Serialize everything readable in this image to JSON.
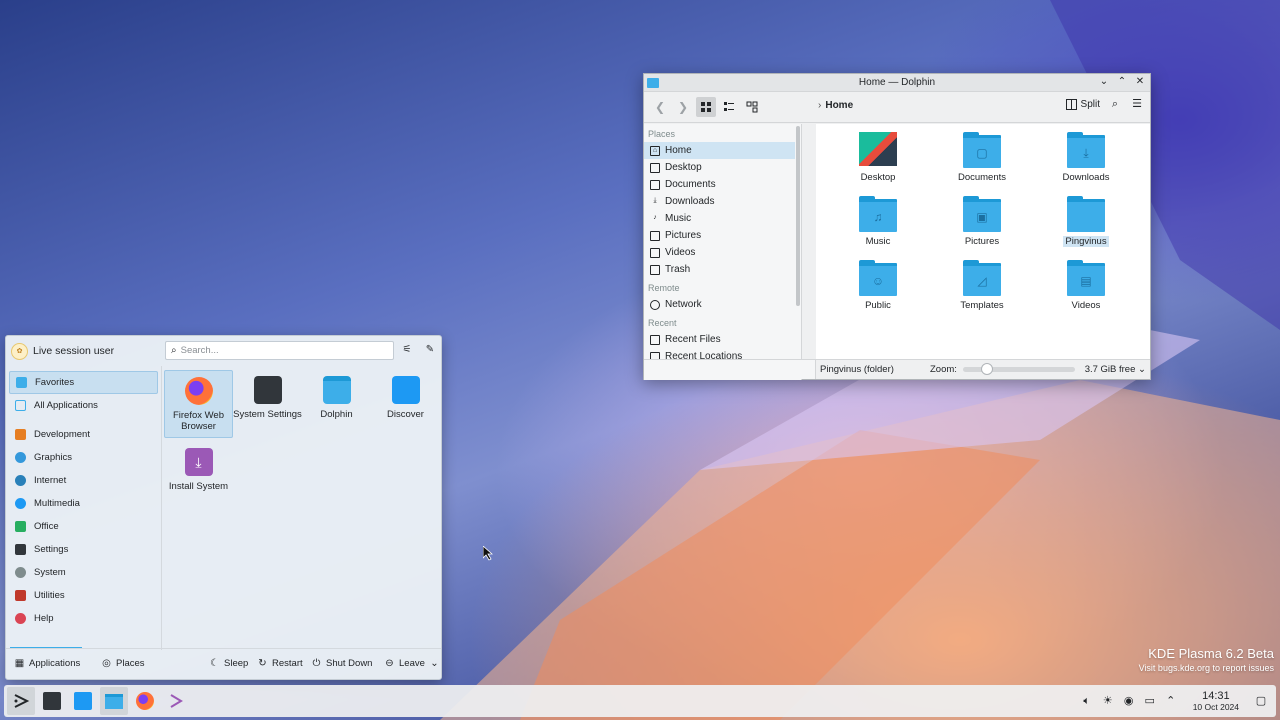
{
  "dolphin": {
    "title": "Home — Dolphin",
    "breadcrumb": "Home",
    "split_label": "Split",
    "places_section": "Places",
    "places": [
      "Home",
      "Desktop",
      "Documents",
      "Downloads",
      "Music",
      "Pictures",
      "Videos",
      "Trash"
    ],
    "remote_section": "Remote",
    "remote": [
      "Network"
    ],
    "recent_section": "Recent",
    "recent": [
      "Recent Files",
      "Recent Locations"
    ],
    "files": [
      "Desktop",
      "Documents",
      "Downloads",
      "Music",
      "Pictures",
      "Pingvinus",
      "Public",
      "Templates",
      "Videos"
    ],
    "selected_file": "Pingvinus",
    "status": "Pingvinus (folder)",
    "zoom_label": "Zoom:",
    "free_space": "3.7 GiB free"
  },
  "kickoff": {
    "user": "Live session user",
    "search_placeholder": "Search...",
    "categories": [
      "Favorites",
      "All Applications",
      "Development",
      "Graphics",
      "Internet",
      "Multimedia",
      "Office",
      "Settings",
      "System",
      "Utilities",
      "Help"
    ],
    "apps": [
      "Firefox Web Browser",
      "System Settings",
      "Dolphin",
      "Discover",
      "Install System"
    ],
    "footer": {
      "applications": "Applications",
      "places": "Places",
      "sleep": "Sleep",
      "restart": "Restart",
      "shutdown": "Shut Down",
      "leave": "Leave"
    }
  },
  "watermark": {
    "line1": "KDE Plasma 6.2 Beta",
    "line2": "Visit bugs.kde.org to report issues"
  },
  "panel": {
    "time": "14:31",
    "date": "10 Oct 2024"
  },
  "colors": {
    "accent": "#3daee9",
    "selection": "#cfe4f3",
    "folder": "#3daee9"
  }
}
